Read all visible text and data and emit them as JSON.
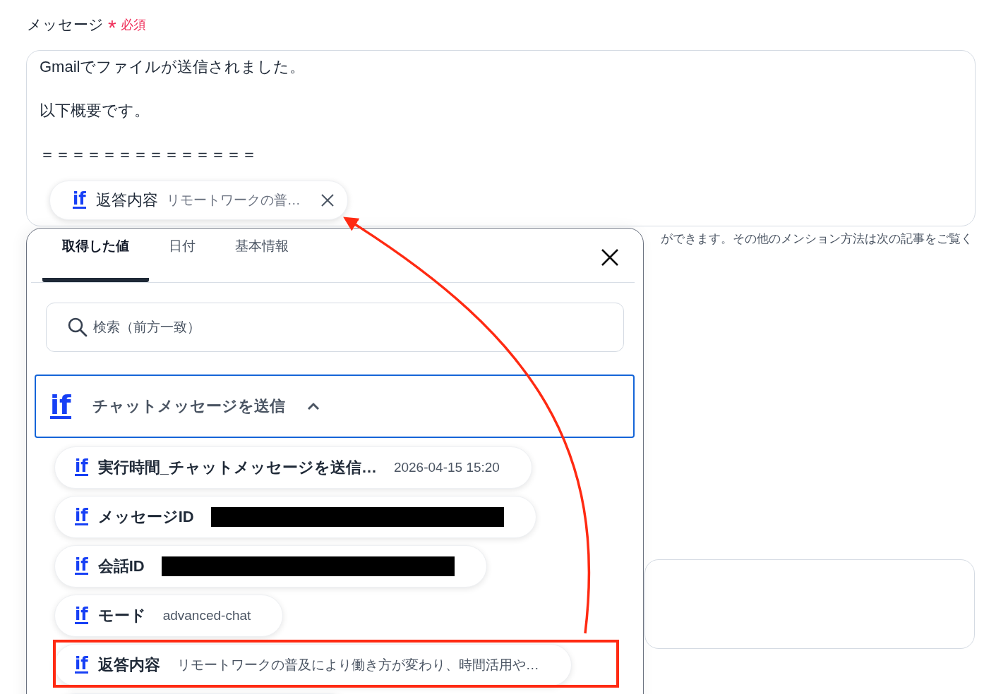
{
  "field": {
    "label": "メッセージ",
    "required_mark": "*",
    "required_text": "必須",
    "lines": [
      "Gmailでファイルが送信されました。",
      "以下概要です。",
      "＝＝＝＝＝＝＝＝＝＝＝＝＝＝"
    ],
    "chip": {
      "icon": "if",
      "label": "返答内容",
      "value": "リモートワークの普…"
    },
    "help_text": "ができます。その他のメンション方法は次の記事をご覧く"
  },
  "picker": {
    "tabs": [
      {
        "label": "取得した値",
        "selected": true
      },
      {
        "label": "日付",
        "selected": false
      },
      {
        "label": "基本情報",
        "selected": false
      }
    ],
    "search": {
      "placeholder": "検索（前方一致）"
    },
    "group": {
      "icon": "if",
      "title": "チャットメッセージを送信",
      "expanded": true
    },
    "items": [
      {
        "icon": "if",
        "label": "実行時間_チャットメッセージを送信…",
        "value": "2026-04-15 15:20",
        "redacted": false,
        "highlighted": false
      },
      {
        "icon": "if",
        "label": "メッセージID",
        "redacted": true,
        "highlighted": false
      },
      {
        "icon": "if",
        "label": "会話ID",
        "redacted": true,
        "highlighted": false
      },
      {
        "icon": "if",
        "label": "モード",
        "value": "advanced-chat",
        "redacted": false,
        "highlighted": false
      },
      {
        "icon": "if",
        "label": "返答内容",
        "value": "リモートワークの普及により働き方が変わり、時間活用や…",
        "redacted": false,
        "highlighted": true
      }
    ]
  }
}
